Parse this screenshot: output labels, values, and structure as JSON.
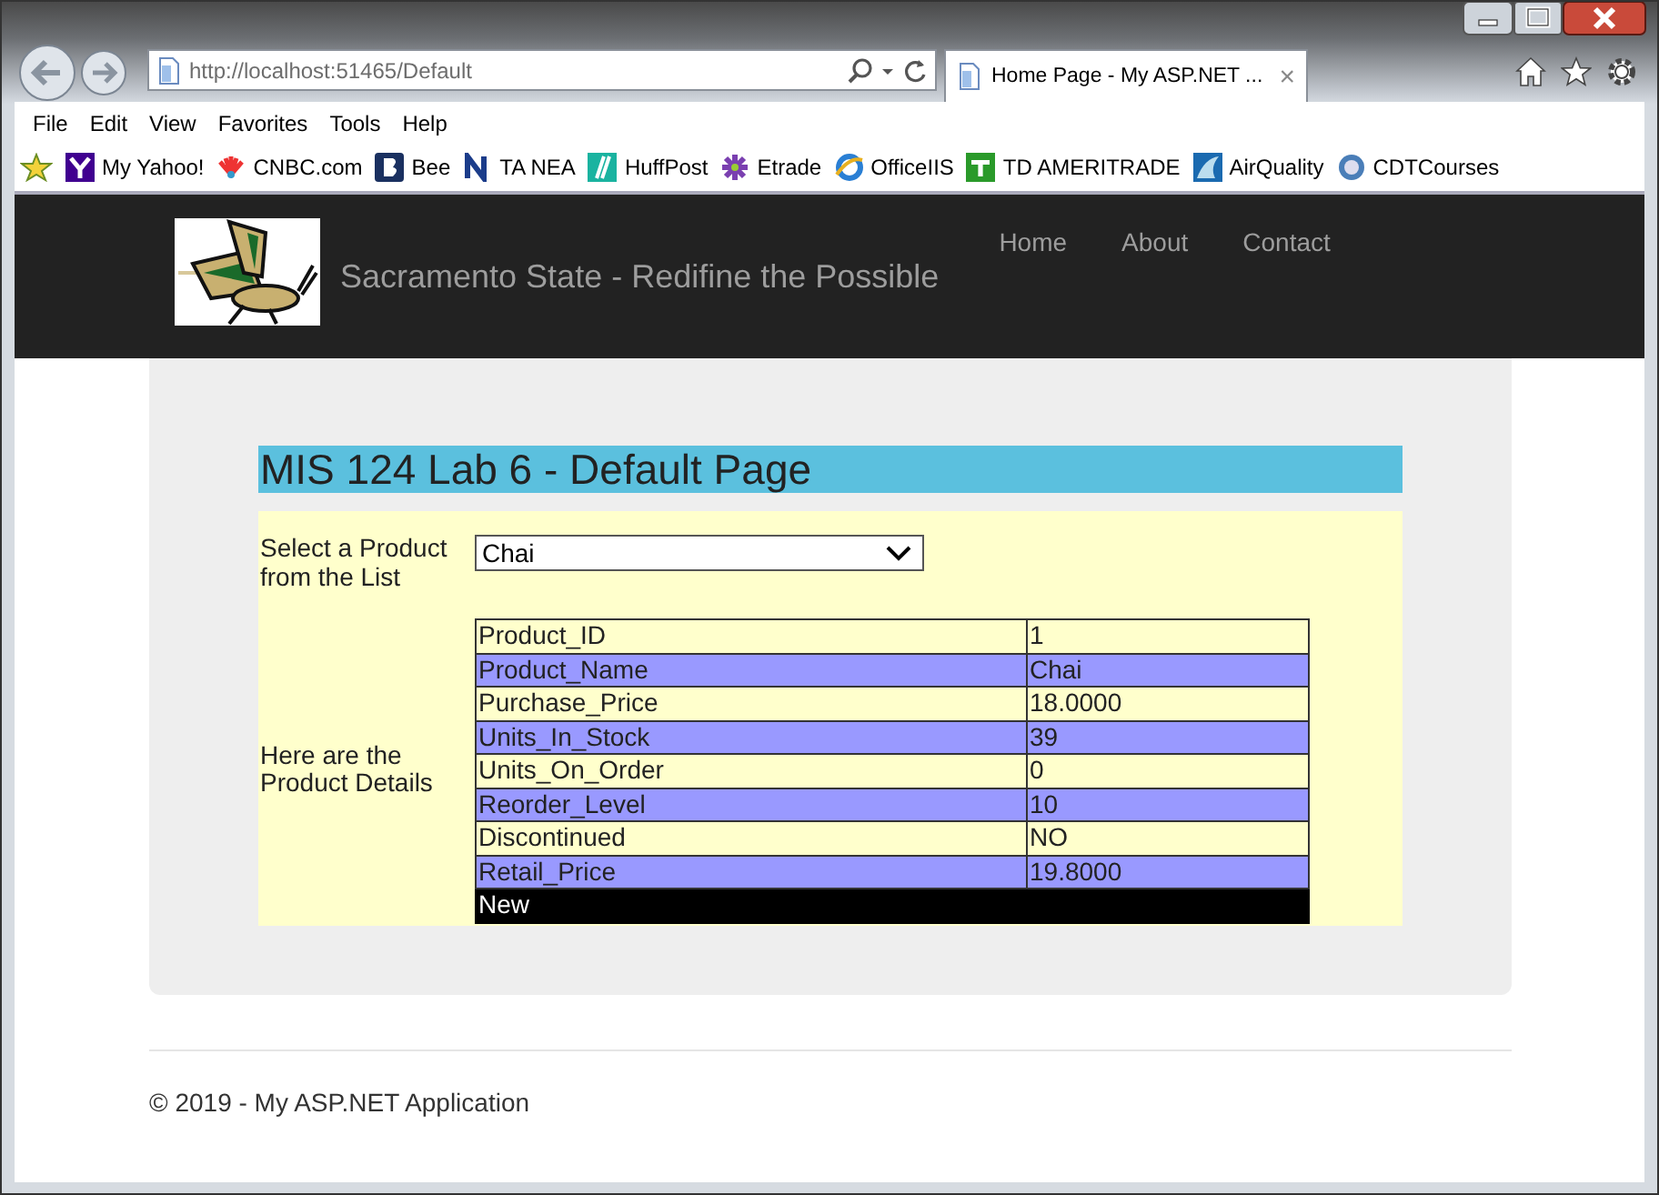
{
  "browser": {
    "address": "http://localhost:51465/Default",
    "tab_title": "Home Page - My ASP.NET ...",
    "tab_close": "×",
    "menu": [
      "File",
      "Edit",
      "View",
      "Favorites",
      "Tools",
      "Help"
    ],
    "favorites": [
      "My Yahoo!",
      "CNBC.com",
      "Bee",
      "TA NEA",
      "HuffPost",
      "Etrade",
      "OfficeIIS",
      "TD AMERITRADE",
      "AirQuality",
      "CDTCourses"
    ]
  },
  "site": {
    "brand": "Sacramento State - Redifine the Possible",
    "nav": [
      "Home",
      "About",
      "Contact"
    ]
  },
  "content": {
    "heading": "MIS 124 Lab 6 - Default Page",
    "select_label": "Select a Product from the List",
    "select_value": "Chai",
    "details_label": "Here are the Product Details",
    "rows": [
      {
        "field": "Product_ID",
        "value": "1"
      },
      {
        "field": "Product_Name",
        "value": "Chai"
      },
      {
        "field": "Purchase_Price",
        "value": "18.0000"
      },
      {
        "field": "Units_In_Stock",
        "value": "39"
      },
      {
        "field": "Units_On_Order",
        "value": "0"
      },
      {
        "field": "Reorder_Level",
        "value": "10"
      },
      {
        "field": "Discontinued",
        "value": "NO"
      },
      {
        "field": "Retail_Price",
        "value": "19.8000"
      }
    ],
    "footer_link": "New"
  },
  "footer": "© 2019 - My ASP.NET Application"
}
